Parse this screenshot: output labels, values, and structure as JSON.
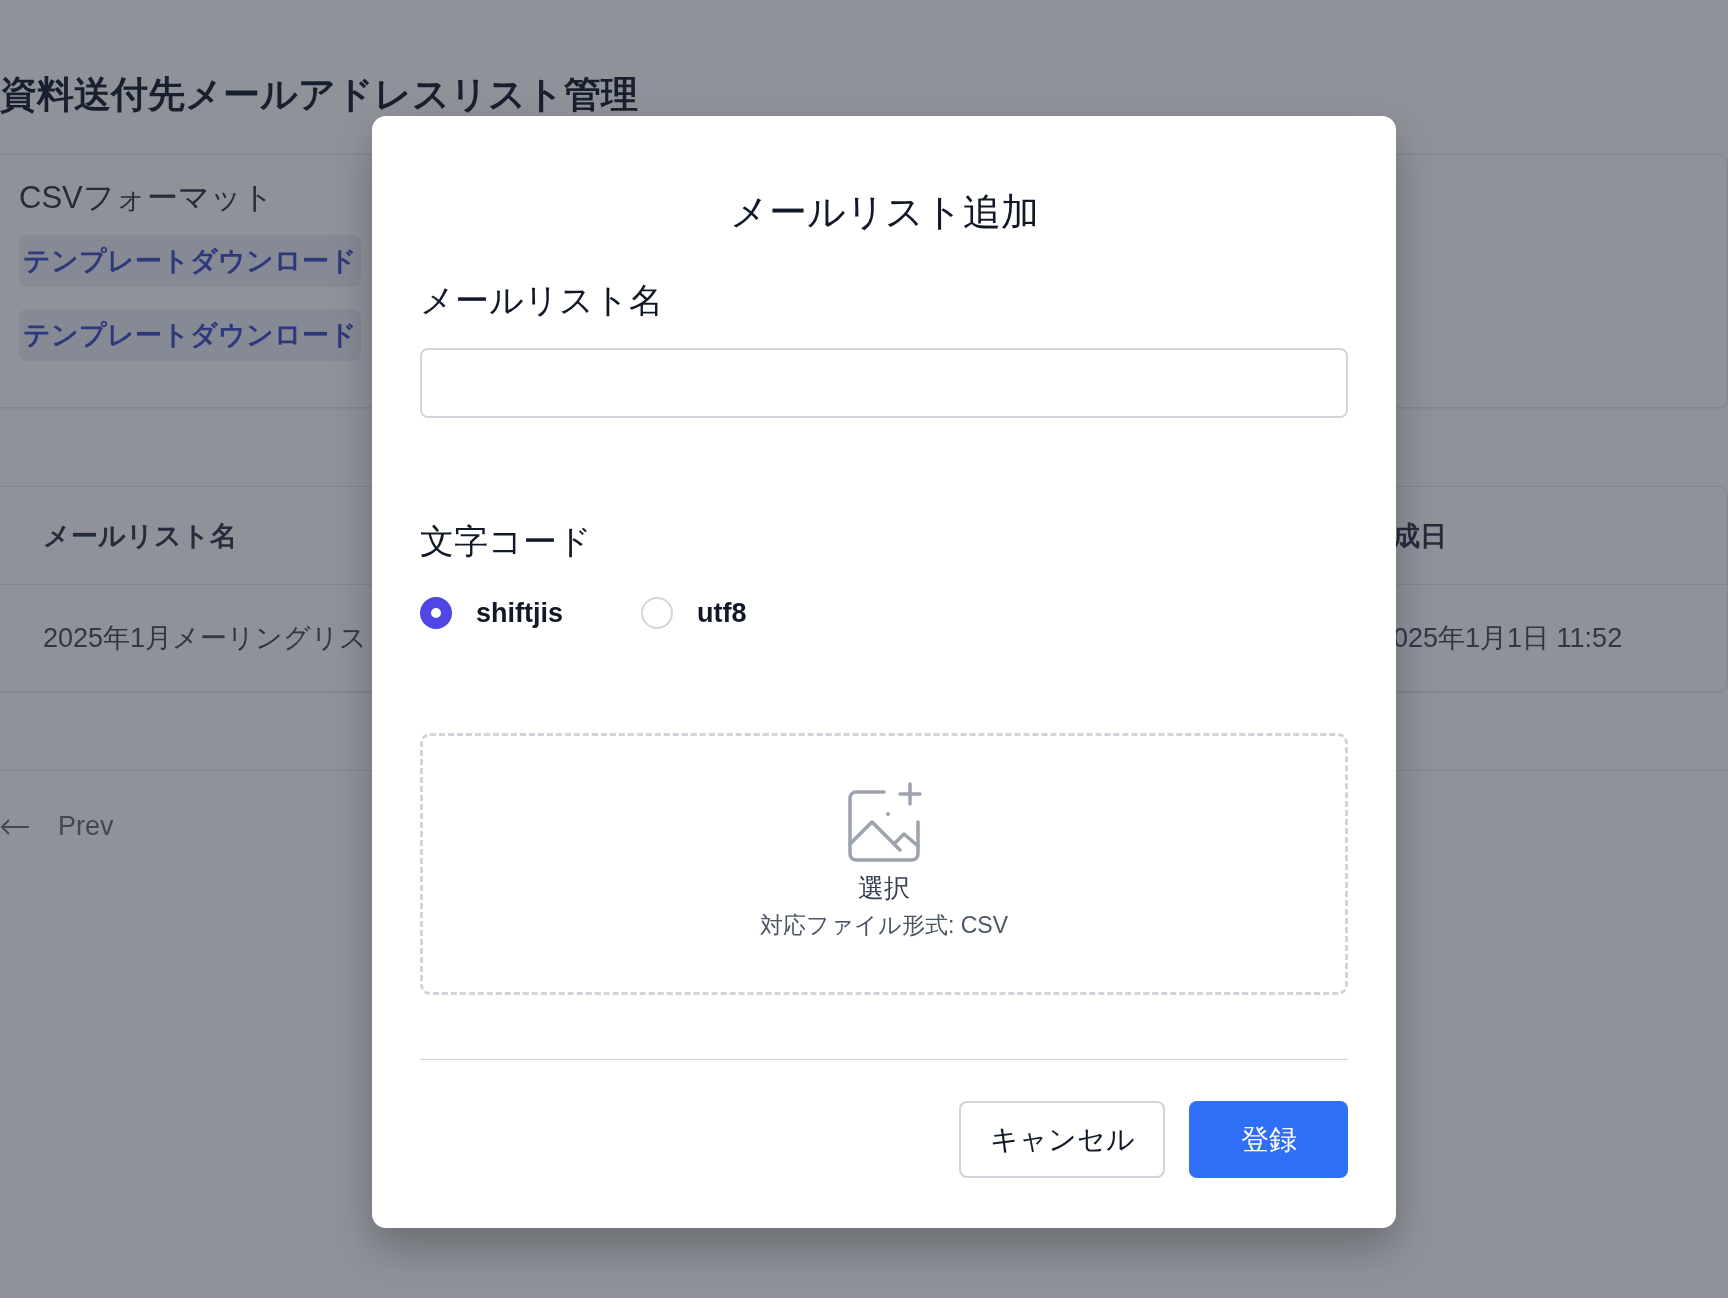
{
  "page": {
    "title": "資料送付先メールアドレスリスト管理",
    "csv_format": {
      "heading": "CSVフォーマット",
      "links": [
        "テンプレートダウンロード",
        "テンプレートダウンロード"
      ]
    },
    "table": {
      "columns": [
        "メールリスト名",
        "成日"
      ],
      "rows": [
        [
          "2025年1月メーリングリス",
          "025年1月1日 11:52"
        ]
      ]
    },
    "pagination": {
      "prev": "Prev"
    }
  },
  "modal": {
    "title": "メールリスト追加",
    "name_field": {
      "label": "メールリスト名"
    },
    "encoding": {
      "label": "文字コード",
      "options": [
        {
          "label": "shiftjis",
          "selected": true
        },
        {
          "label": "utf8",
          "selected": false
        }
      ]
    },
    "dropzone": {
      "action": "選択",
      "hint": "対応ファイル形式: CSV"
    },
    "buttons": [
      {
        "label": "キャンセル",
        "kind": "secondary"
      },
      {
        "label": "登録",
        "kind": "primary"
      }
    ]
  }
}
